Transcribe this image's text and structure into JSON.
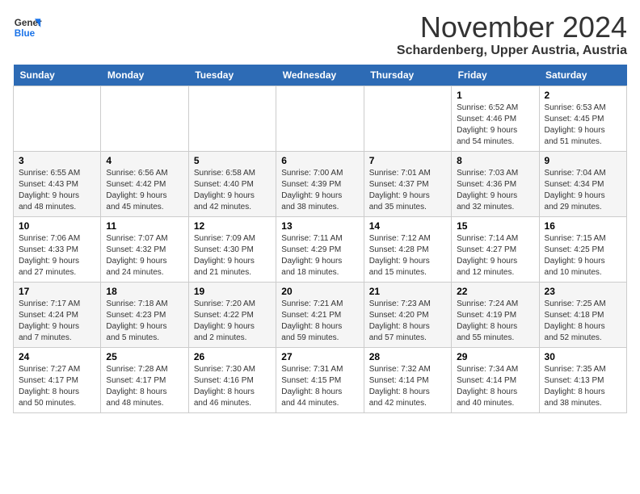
{
  "logo": {
    "line1": "General",
    "line2": "Blue"
  },
  "title": "November 2024",
  "location": "Schardenberg, Upper Austria, Austria",
  "days_of_week": [
    "Sunday",
    "Monday",
    "Tuesday",
    "Wednesday",
    "Thursday",
    "Friday",
    "Saturday"
  ],
  "weeks": [
    [
      {
        "day": "",
        "detail": ""
      },
      {
        "day": "",
        "detail": ""
      },
      {
        "day": "",
        "detail": ""
      },
      {
        "day": "",
        "detail": ""
      },
      {
        "day": "",
        "detail": ""
      },
      {
        "day": "1",
        "detail": "Sunrise: 6:52 AM\nSunset: 4:46 PM\nDaylight: 9 hours\nand 54 minutes."
      },
      {
        "day": "2",
        "detail": "Sunrise: 6:53 AM\nSunset: 4:45 PM\nDaylight: 9 hours\nand 51 minutes."
      }
    ],
    [
      {
        "day": "3",
        "detail": "Sunrise: 6:55 AM\nSunset: 4:43 PM\nDaylight: 9 hours\nand 48 minutes."
      },
      {
        "day": "4",
        "detail": "Sunrise: 6:56 AM\nSunset: 4:42 PM\nDaylight: 9 hours\nand 45 minutes."
      },
      {
        "day": "5",
        "detail": "Sunrise: 6:58 AM\nSunset: 4:40 PM\nDaylight: 9 hours\nand 42 minutes."
      },
      {
        "day": "6",
        "detail": "Sunrise: 7:00 AM\nSunset: 4:39 PM\nDaylight: 9 hours\nand 38 minutes."
      },
      {
        "day": "7",
        "detail": "Sunrise: 7:01 AM\nSunset: 4:37 PM\nDaylight: 9 hours\nand 35 minutes."
      },
      {
        "day": "8",
        "detail": "Sunrise: 7:03 AM\nSunset: 4:36 PM\nDaylight: 9 hours\nand 32 minutes."
      },
      {
        "day": "9",
        "detail": "Sunrise: 7:04 AM\nSunset: 4:34 PM\nDaylight: 9 hours\nand 29 minutes."
      }
    ],
    [
      {
        "day": "10",
        "detail": "Sunrise: 7:06 AM\nSunset: 4:33 PM\nDaylight: 9 hours\nand 27 minutes."
      },
      {
        "day": "11",
        "detail": "Sunrise: 7:07 AM\nSunset: 4:32 PM\nDaylight: 9 hours\nand 24 minutes."
      },
      {
        "day": "12",
        "detail": "Sunrise: 7:09 AM\nSunset: 4:30 PM\nDaylight: 9 hours\nand 21 minutes."
      },
      {
        "day": "13",
        "detail": "Sunrise: 7:11 AM\nSunset: 4:29 PM\nDaylight: 9 hours\nand 18 minutes."
      },
      {
        "day": "14",
        "detail": "Sunrise: 7:12 AM\nSunset: 4:28 PM\nDaylight: 9 hours\nand 15 minutes."
      },
      {
        "day": "15",
        "detail": "Sunrise: 7:14 AM\nSunset: 4:27 PM\nDaylight: 9 hours\nand 12 minutes."
      },
      {
        "day": "16",
        "detail": "Sunrise: 7:15 AM\nSunset: 4:25 PM\nDaylight: 9 hours\nand 10 minutes."
      }
    ],
    [
      {
        "day": "17",
        "detail": "Sunrise: 7:17 AM\nSunset: 4:24 PM\nDaylight: 9 hours\nand 7 minutes."
      },
      {
        "day": "18",
        "detail": "Sunrise: 7:18 AM\nSunset: 4:23 PM\nDaylight: 9 hours\nand 5 minutes."
      },
      {
        "day": "19",
        "detail": "Sunrise: 7:20 AM\nSunset: 4:22 PM\nDaylight: 9 hours\nand 2 minutes."
      },
      {
        "day": "20",
        "detail": "Sunrise: 7:21 AM\nSunset: 4:21 PM\nDaylight: 8 hours\nand 59 minutes."
      },
      {
        "day": "21",
        "detail": "Sunrise: 7:23 AM\nSunset: 4:20 PM\nDaylight: 8 hours\nand 57 minutes."
      },
      {
        "day": "22",
        "detail": "Sunrise: 7:24 AM\nSunset: 4:19 PM\nDaylight: 8 hours\nand 55 minutes."
      },
      {
        "day": "23",
        "detail": "Sunrise: 7:25 AM\nSunset: 4:18 PM\nDaylight: 8 hours\nand 52 minutes."
      }
    ],
    [
      {
        "day": "24",
        "detail": "Sunrise: 7:27 AM\nSunset: 4:17 PM\nDaylight: 8 hours\nand 50 minutes."
      },
      {
        "day": "25",
        "detail": "Sunrise: 7:28 AM\nSunset: 4:17 PM\nDaylight: 8 hours\nand 48 minutes."
      },
      {
        "day": "26",
        "detail": "Sunrise: 7:30 AM\nSunset: 4:16 PM\nDaylight: 8 hours\nand 46 minutes."
      },
      {
        "day": "27",
        "detail": "Sunrise: 7:31 AM\nSunset: 4:15 PM\nDaylight: 8 hours\nand 44 minutes."
      },
      {
        "day": "28",
        "detail": "Sunrise: 7:32 AM\nSunset: 4:14 PM\nDaylight: 8 hours\nand 42 minutes."
      },
      {
        "day": "29",
        "detail": "Sunrise: 7:34 AM\nSunset: 4:14 PM\nDaylight: 8 hours\nand 40 minutes."
      },
      {
        "day": "30",
        "detail": "Sunrise: 7:35 AM\nSunset: 4:13 PM\nDaylight: 8 hours\nand 38 minutes."
      }
    ]
  ]
}
